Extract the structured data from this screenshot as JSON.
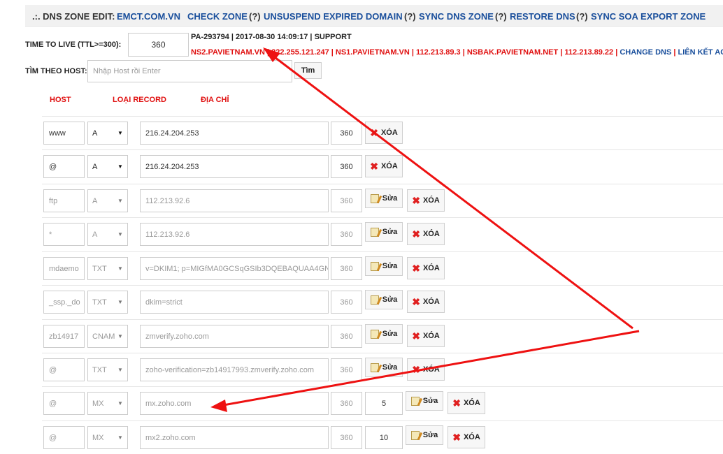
{
  "header": {
    "prefix": ".:. DNS ZONE EDIT:",
    "domain": "EMCT.COM.VN",
    "actions": [
      {
        "label": "CHECK ZONE",
        "help": "(?)"
      },
      {
        "label": "UNSUSPEND EXPIRED DOMAIN",
        "help": "(?)"
      },
      {
        "label": "SYNC DNS ZONE",
        "help": "(?)"
      },
      {
        "label": "RESTORE DNS",
        "help": "(?)"
      },
      {
        "label": "SYNC SOA EXPORT ZONE",
        "help": ""
      }
    ]
  },
  "ttl": {
    "label": "TIME TO LIVE (TTL>=300):",
    "value": "360"
  },
  "info": {
    "line1": "PA-293794 | 2017-08-30 14:09:17 | SUPPORT",
    "line2_ns": "NS2.PAVIETNAM.VN | 222.255.121.247 | NS1.PAVIETNAM.VN | 112.213.89.3 | NSBAK.PAVIETNAM.NET | 112.213.89.22 | ",
    "change_dns": "CHANGE DNS",
    "sep": " | ",
    "link": "LIÊN KẾT ACC"
  },
  "search": {
    "label": "TÌM THEO HOST:",
    "placeholder": "Nhập Host rồi Enter",
    "button": "Tìm"
  },
  "columns": {
    "host": "HOST",
    "type": "LOẠI RECORD",
    "address": "ĐỊA CHỈ"
  },
  "buttons": {
    "edit": "Sửa",
    "delete": "XÓA"
  },
  "records": [
    {
      "host": "www",
      "type": "A",
      "address": "216.24.204.253",
      "ttl": "360",
      "priority": "",
      "editable": false
    },
    {
      "host": "@",
      "type": "A",
      "address": "216.24.204.253",
      "ttl": "360",
      "priority": "",
      "editable": false
    },
    {
      "host": "ftp",
      "type": "A",
      "address": "112.213.92.6",
      "ttl": "360",
      "priority": "",
      "editable": true
    },
    {
      "host": "*",
      "type": "A",
      "address": "112.213.92.6",
      "ttl": "360",
      "priority": "",
      "editable": true
    },
    {
      "host": "mdaemo",
      "type": "TXT",
      "address": "v=DKIM1; p=MIGfMA0GCSqGSIb3DQEBAQUAA4GN",
      "ttl": "360",
      "priority": "",
      "editable": true
    },
    {
      "host": "_ssp._do",
      "type": "TXT",
      "address": "dkim=strict",
      "ttl": "360",
      "priority": "",
      "editable": true
    },
    {
      "host": "zb14917",
      "type": "CNAM",
      "address": "zmverify.zoho.com",
      "ttl": "360",
      "priority": "",
      "editable": true
    },
    {
      "host": "@",
      "type": "TXT",
      "address": "zoho-verification=zb14917993.zmverify.zoho.com",
      "ttl": "360",
      "priority": "",
      "editable": true
    },
    {
      "host": "@",
      "type": "MX",
      "address": "mx.zoho.com",
      "ttl": "360",
      "priority": "5",
      "editable": true
    },
    {
      "host": "@",
      "type": "MX",
      "address": "mx2.zoho.com",
      "ttl": "360",
      "priority": "10",
      "editable": true
    }
  ],
  "annotation_color": "#ee1111"
}
